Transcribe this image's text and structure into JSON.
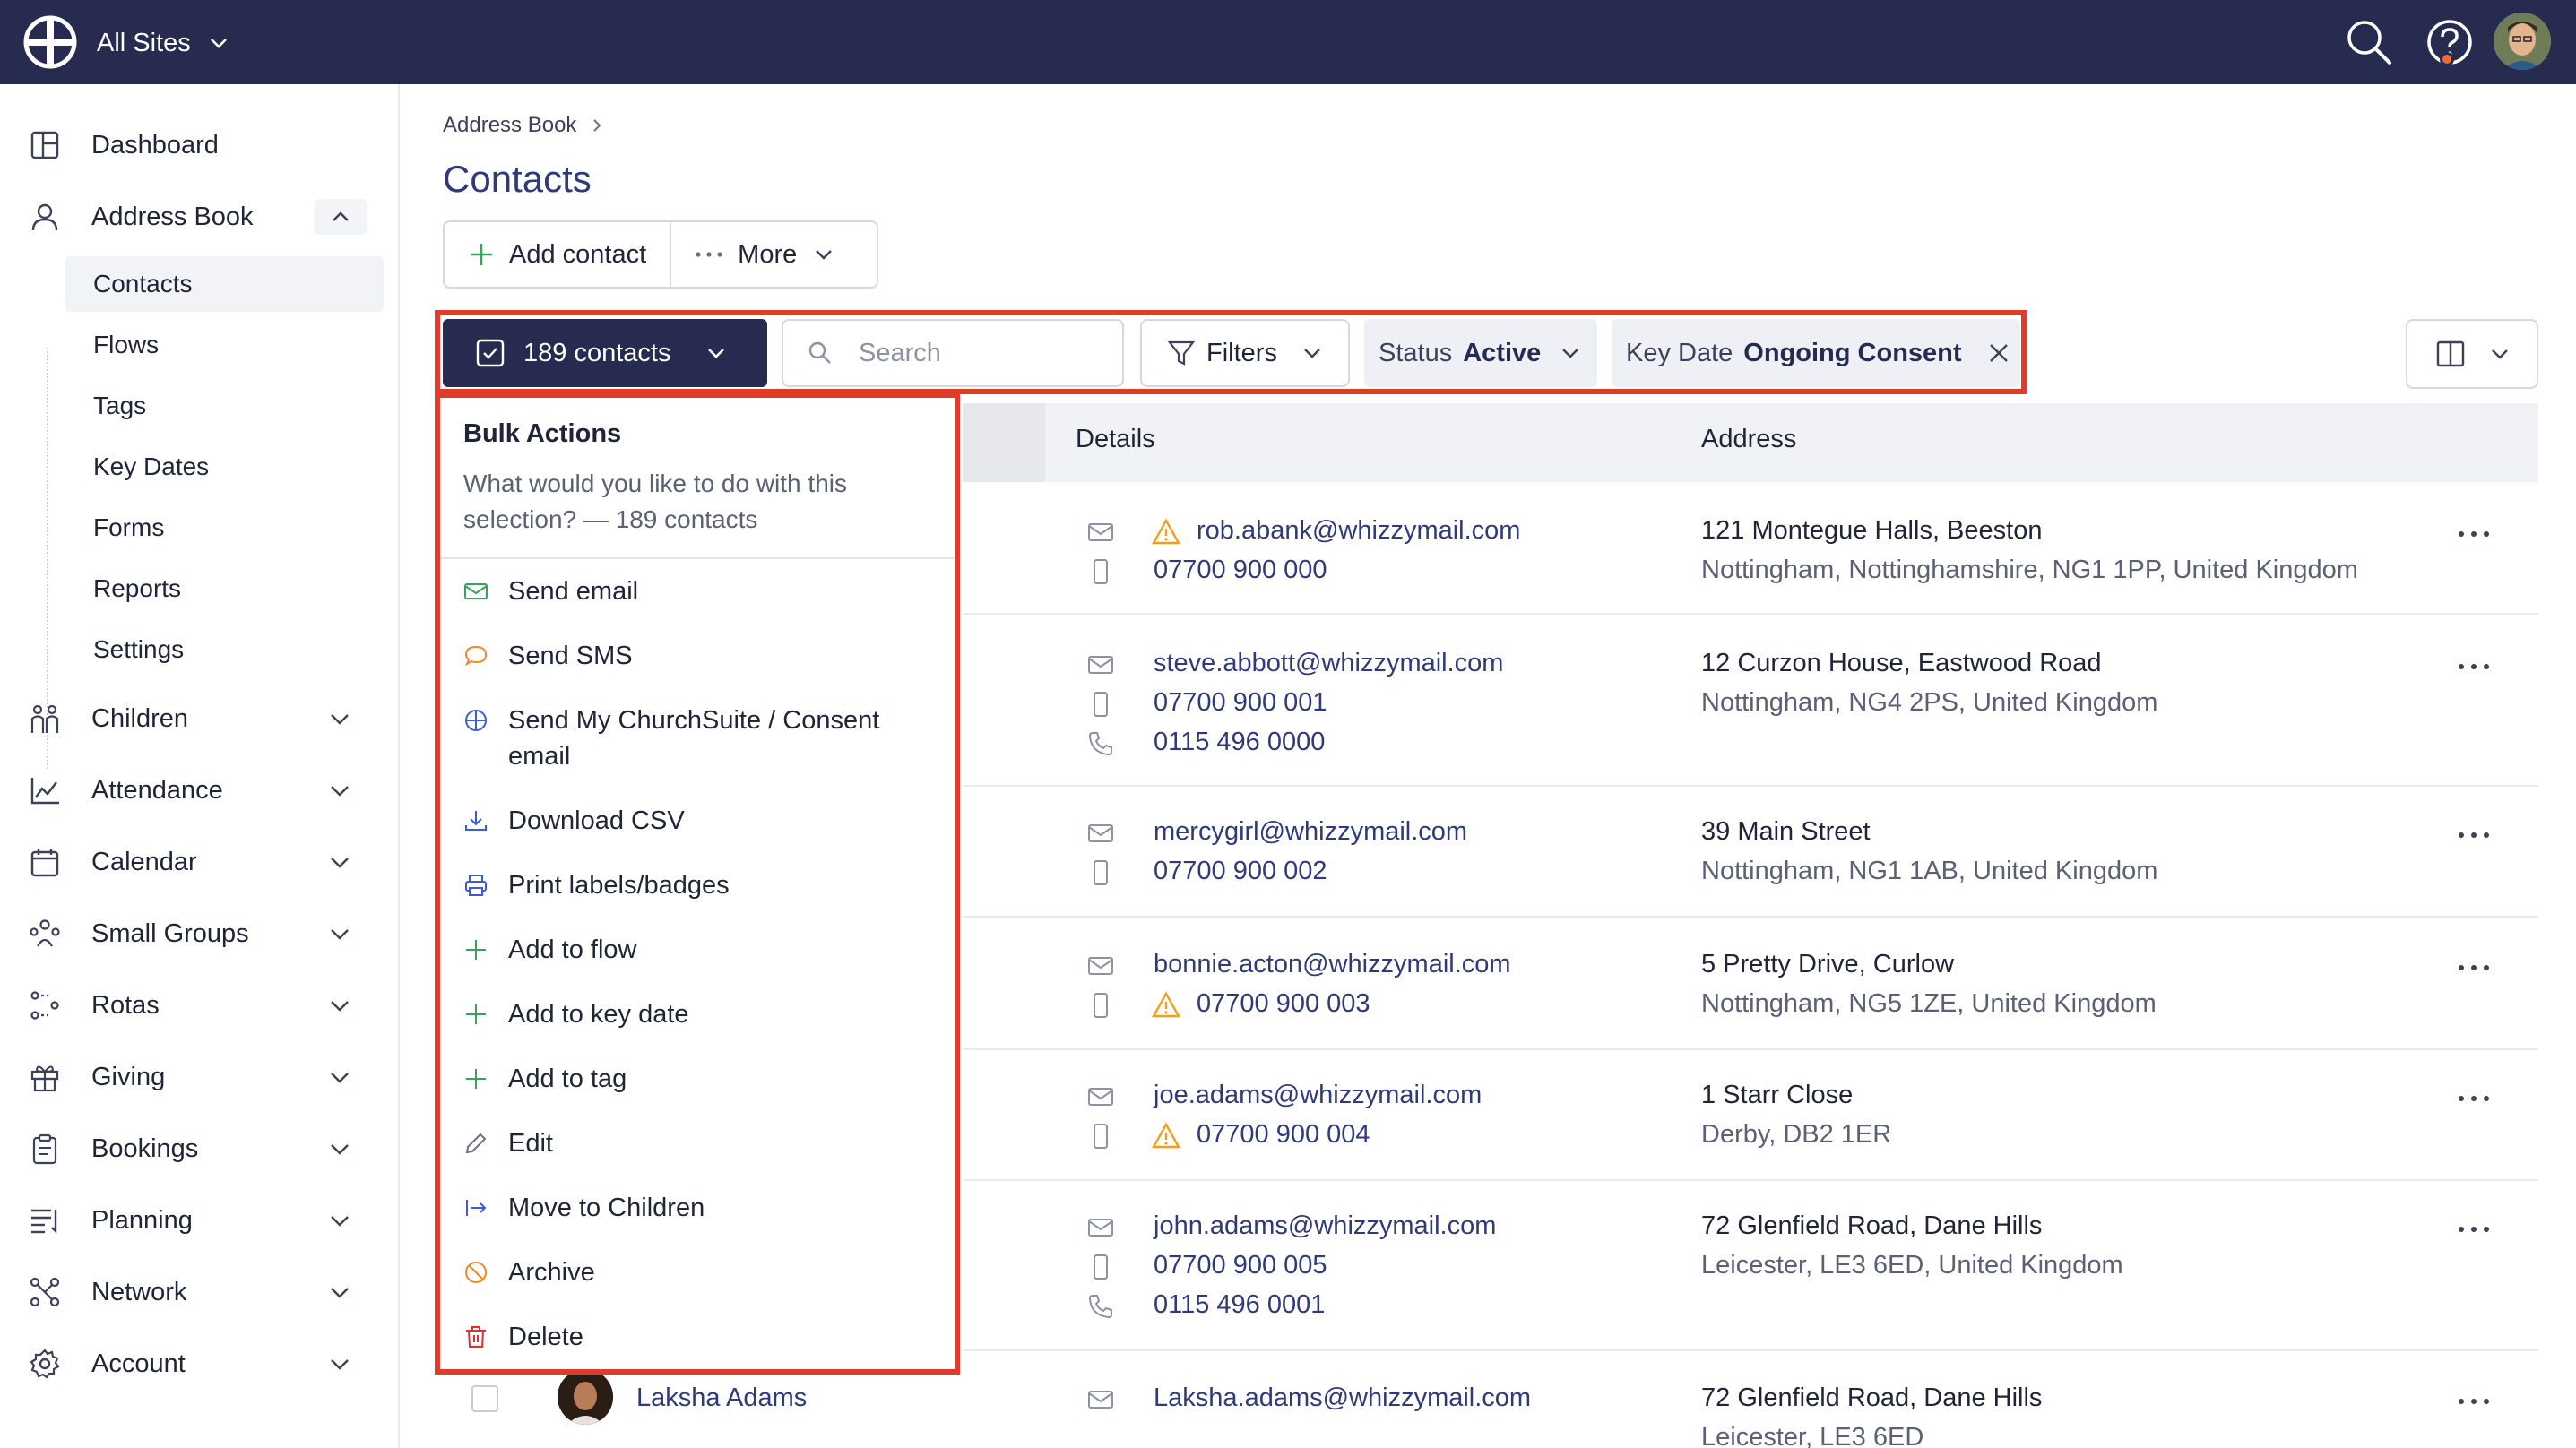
{
  "topbar": {
    "site_switch_label": "All Sites",
    "icons": [
      "logo-icon",
      "search-icon",
      "help-icon",
      "avatar"
    ]
  },
  "sidebar": {
    "items": [
      {
        "label": "Dashboard",
        "icon": "dashboard-icon"
      },
      {
        "label": "Address Book",
        "icon": "person-icon",
        "expanded": true,
        "children": [
          "Contacts",
          "Flows",
          "Tags",
          "Key Dates",
          "Forms",
          "Reports",
          "Settings"
        ],
        "active_child": "Contacts"
      },
      {
        "label": "Children",
        "icon": "children-icon"
      },
      {
        "label": "Attendance",
        "icon": "attendance-icon"
      },
      {
        "label": "Calendar",
        "icon": "calendar-icon"
      },
      {
        "label": "Small Groups",
        "icon": "groups-icon"
      },
      {
        "label": "Rotas",
        "icon": "rotas-icon"
      },
      {
        "label": "Giving",
        "icon": "gift-icon"
      },
      {
        "label": "Bookings",
        "icon": "bookings-icon"
      },
      {
        "label": "Planning",
        "icon": "planning-icon"
      },
      {
        "label": "Network",
        "icon": "network-icon"
      },
      {
        "label": "Account",
        "icon": "gear-icon"
      }
    ]
  },
  "main": {
    "breadcrumb": "Address Book",
    "title": "Contacts",
    "add_contact_label": "Add contact",
    "more_label": "More"
  },
  "toolbar": {
    "contacts_count_label": "189 contacts",
    "search_placeholder": "Search",
    "filters_label": "Filters",
    "status_chip": {
      "key": "Status",
      "value": "Active"
    },
    "keydate_chip": {
      "key": "Key Date",
      "value": "Ongoing Consent"
    }
  },
  "table": {
    "columns": [
      "Details",
      "Address"
    ],
    "rows": [
      {
        "email": "rob.abank@whizzymail.com",
        "email_warning": true,
        "mobile": "07700 900 000",
        "mobile_warning": false,
        "phone": "",
        "address1": "121 Montegue Halls, Beeston",
        "address2": "Nottingham, Nottinghamshire, NG1 1PP, United Kingdom"
      },
      {
        "email": "steve.abbott@whizzymail.com",
        "email_warning": false,
        "mobile": "07700 900 001",
        "mobile_warning": false,
        "phone": "0115 496 0000",
        "address1": "12 Curzon House, Eastwood Road",
        "address2": "Nottingham, NG4 2PS, United Kingdom"
      },
      {
        "email": "mercygirl@whizzymail.com",
        "email_warning": false,
        "mobile": "07700 900 002",
        "mobile_warning": false,
        "phone": "",
        "address1": "39 Main Street",
        "address2": "Nottingham, NG1 1AB, United Kingdom"
      },
      {
        "email": "bonnie.acton@whizzymail.com",
        "email_warning": false,
        "mobile": "07700 900 003",
        "mobile_warning": true,
        "phone": "",
        "address1": "5 Pretty Drive, Curlow",
        "address2": "Nottingham, NG5 1ZE, United Kingdom"
      },
      {
        "email": "joe.adams@whizzymail.com",
        "email_warning": false,
        "mobile": "07700 900 004",
        "mobile_warning": true,
        "phone": "",
        "address1": "1 Starr Close",
        "address2": "Derby, DB2 1ER"
      },
      {
        "email": "john.adams@whizzymail.com",
        "email_warning": false,
        "mobile": "07700 900 005",
        "mobile_warning": false,
        "phone": "0115 496 0001",
        "address1": "72 Glenfield Road, Dane Hills",
        "address2": "Leicester, LE3 6ED, United Kingdom"
      },
      {
        "name": "Laksha Adams",
        "email": "Laksha.adams@whizzymail.com",
        "email_warning": false,
        "mobile": "",
        "mobile_warning": false,
        "phone": "",
        "address1": "72 Glenfield Road, Dane Hills",
        "address2": "Leicester, LE3 6ED"
      }
    ]
  },
  "bulk_menu": {
    "title": "Bulk Actions",
    "description": "What would you like to do with this selection? — 189 contacts",
    "items": [
      {
        "label": "Send email",
        "icon": "mail-icon",
        "color": "#3aa35b"
      },
      {
        "label": "Send SMS",
        "icon": "chat-icon",
        "color": "#ef8a2b"
      },
      {
        "label": "Send My ChurchSuite / Consent email",
        "icon": "globe-icon",
        "color": "#3b5bdb"
      },
      {
        "label": "Download CSV",
        "icon": "download-icon",
        "color": "#3b5bdb"
      },
      {
        "label": "Print labels/badges",
        "icon": "print-icon",
        "color": "#3b5bdb"
      },
      {
        "label": "Add to flow",
        "icon": "plus-icon",
        "color": "#3aa35b"
      },
      {
        "label": "Add to key date",
        "icon": "plus-icon",
        "color": "#3aa35b"
      },
      {
        "label": "Add to tag",
        "icon": "plus-icon",
        "color": "#3aa35b"
      },
      {
        "label": "Edit",
        "icon": "pencil-icon",
        "color": "#6b7084"
      },
      {
        "label": "Move to Children",
        "icon": "move-icon",
        "color": "#3b5bdb"
      },
      {
        "label": "Archive",
        "icon": "archive-icon",
        "color": "#ef8a2b"
      },
      {
        "label": "Delete",
        "icon": "trash-icon",
        "color": "#e03131"
      }
    ]
  },
  "colors": {
    "topbar": "#262b4f",
    "highlight": "#e33b2b",
    "link": "#2f3a7a",
    "warning": "#f0a020"
  }
}
